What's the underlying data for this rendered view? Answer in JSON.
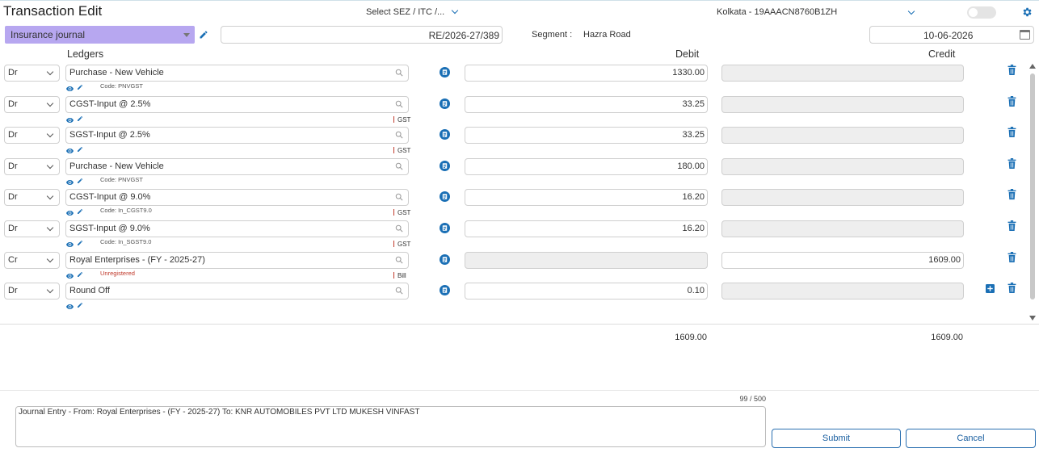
{
  "header": {
    "title": "Transaction Edit",
    "sez_select": "Select SEZ / ITC /...",
    "gstin_select": "Kolkata - 19AAACN8760B1ZH"
  },
  "form": {
    "journal_type": "Insurance journal",
    "voucher_no": "RE/2026-27/389",
    "segment_label": "Segment :",
    "segment_value": "Hazra Road",
    "date": "10-06-2026"
  },
  "table": {
    "headers": {
      "ledgers": "Ledgers",
      "debit": "Debit",
      "credit": "Credit"
    },
    "rows": [
      {
        "drcr": "Dr",
        "ledger": "Purchase - New Vehicle",
        "code": "Code: PNVGST",
        "tag": "",
        "debit": "1330.00",
        "credit": ""
      },
      {
        "drcr": "Dr",
        "ledger": "CGST-Input @ 2.5%",
        "code": "",
        "tag": "GST",
        "debit": "33.25",
        "credit": ""
      },
      {
        "drcr": "Dr",
        "ledger": "SGST-Input @ 2.5%",
        "code": "",
        "tag": "GST",
        "debit": "33.25",
        "credit": ""
      },
      {
        "drcr": "Dr",
        "ledger": "Purchase - New Vehicle",
        "code": "Code: PNVGST",
        "tag": "",
        "debit": "180.00",
        "credit": ""
      },
      {
        "drcr": "Dr",
        "ledger": "CGST-Input @ 9.0%",
        "code": "Code: In_CGST9.0",
        "tag": "GST",
        "debit": "16.20",
        "credit": ""
      },
      {
        "drcr": "Dr",
        "ledger": "SGST-Input @ 9.0%",
        "code": "Code: In_SGST9.0",
        "tag": "GST",
        "debit": "16.20",
        "credit": ""
      },
      {
        "drcr": "Cr",
        "ledger": "Royal Enterprises - (FY - 2025-27)",
        "code": "Unregistered",
        "tag": "Bill",
        "debit": "",
        "credit": "1609.00"
      },
      {
        "drcr": "Dr",
        "ledger": "Round Off",
        "code": "",
        "tag": "",
        "debit": "0.10",
        "credit": ""
      }
    ]
  },
  "totals": {
    "debit": "1609.00",
    "credit": "1609.00"
  },
  "narration": {
    "counter": "99 / 500",
    "text": "Journal Entry - From: Royal Enterprises - (FY - 2025-27) To: KNR AUTOMOBILES PVT LTD MUKESH VINFAST"
  },
  "actions": {
    "submit": "Submit",
    "cancel": "Cancel"
  },
  "colors": {
    "accent": "#1a6fb5",
    "journal_bg": "#b7a7f0",
    "disabled_bg": "#eeeeee",
    "unregistered": "#c0392b"
  }
}
